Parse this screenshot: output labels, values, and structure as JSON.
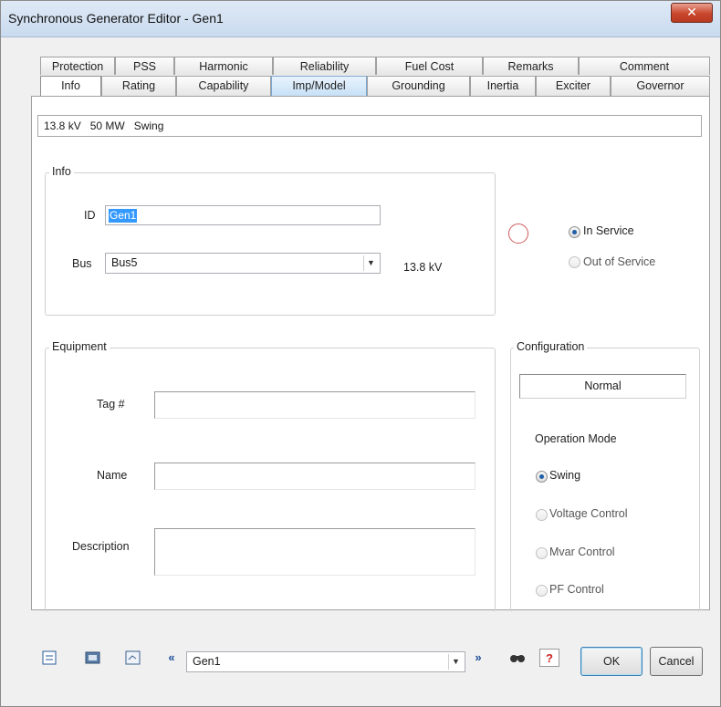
{
  "window": {
    "title": "Synchronous Generator Editor - Gen1",
    "close_glyph": "✕"
  },
  "tabs": {
    "row1": [
      "Protection",
      "PSS",
      "Harmonic",
      "Reliability",
      "Fuel Cost",
      "Remarks",
      "Comment"
    ],
    "row2": [
      "Info",
      "Rating",
      "Capability",
      "Imp/Model",
      "Grounding",
      "Inertia",
      "Exciter",
      "Governor"
    ],
    "active": "Info"
  },
  "summary": "13.8 kV   50 MW   Swing",
  "info": {
    "group_label": "Info",
    "id_label": "ID",
    "id_value": "Gen1",
    "bus_label": "Bus",
    "bus_value": "Bus5",
    "bus_kv": "13.8 kV"
  },
  "service": {
    "in_service": "In Service",
    "out_of_service": "Out of Service",
    "selected": "In Service"
  },
  "equipment": {
    "group_label": "Equipment",
    "tag_label": "Tag #",
    "tag_value": "",
    "name_label": "Name",
    "name_value": "",
    "description_label": "Description",
    "description_value": ""
  },
  "configuration": {
    "group_label": "Configuration",
    "value": "Normal",
    "operation_mode_label": "Operation Mode",
    "modes": [
      "Swing",
      "Voltage Control",
      "Mvar Control",
      "PF Control"
    ],
    "selected_mode": "Swing"
  },
  "footer": {
    "nav_value": "Gen1",
    "ok_label": "OK",
    "cancel_label": "Cancel",
    "help_glyph": "?",
    "find_glyph": "🔍",
    "prev_glyph": "«",
    "next_glyph": "»"
  },
  "colors": {
    "selection_blue": "#3399ff",
    "title_bar": "#c9dbef",
    "close_red": "#c9462c",
    "help_red": "#cc2222"
  }
}
